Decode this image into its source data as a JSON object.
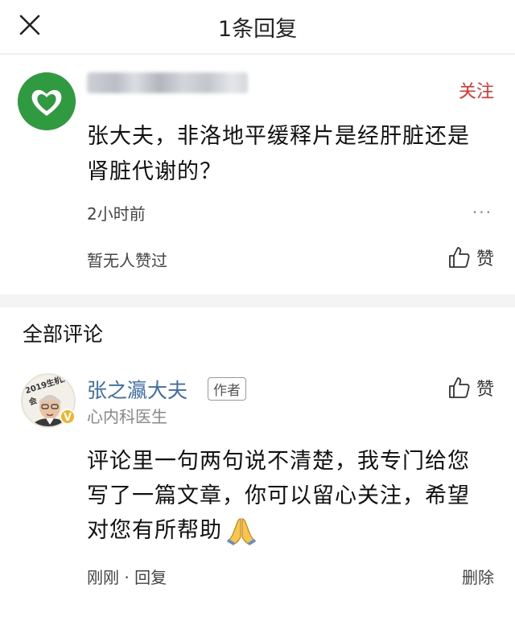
{
  "header": {
    "title": "1条回复",
    "close_icon": "close-icon"
  },
  "question": {
    "follow_label": "关注",
    "text": "张大夫，非洛地平缓释片是经肝脏还是肾脏代谢的？",
    "time": "2小时前",
    "more_label": "···",
    "likes_text": "暂无人赞过",
    "like_label": "赞"
  },
  "comments": {
    "section_title": "全部评论",
    "items": [
      {
        "author": "张之瀛大夫",
        "author_tag": "作者",
        "role": "心内科医生",
        "avatar_ring_text": "2019生机大会",
        "verified_badge": "V",
        "like_label": "赞",
        "text": "评论里一句两句说不清楚，我专门给您写了一篇文章，你可以留心关注，希望对您有所帮助",
        "time": "刚刚",
        "separator": "·",
        "reply_label": "回复",
        "delete_label": "删除"
      }
    ]
  },
  "colors": {
    "accent_red": "#e5322d",
    "author_blue": "#3d6ea8",
    "avatar_green": "#2f9a3f"
  }
}
